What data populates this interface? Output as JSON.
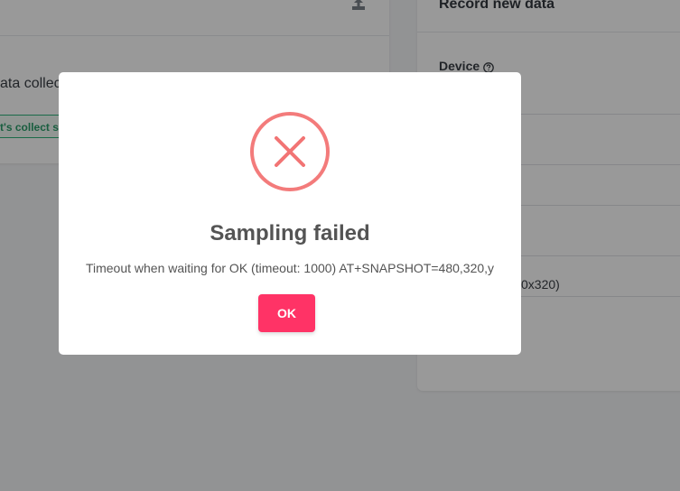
{
  "background": {
    "left_card": {
      "text": "ata collec",
      "collect_button_label": "t's collect so",
      "upload_icon": "upload-icon"
    },
    "right_card": {
      "title": "Record new data",
      "device_label": "Device",
      "help_icon": "question-circle-icon",
      "resolution_text": "0x320)"
    }
  },
  "modal": {
    "icon": "error-x-circle-icon",
    "title": "Sampling failed",
    "message": "Timeout when waiting for OK (timeout: 1000) AT+SNAPSHOT=480,320,y",
    "ok_label": "OK"
  },
  "colors": {
    "error_red": "#f27474",
    "ok_button": "#ff3366",
    "collect_green": "#2a9d6a",
    "overlay": "rgba(0,0,0,0.40)"
  }
}
